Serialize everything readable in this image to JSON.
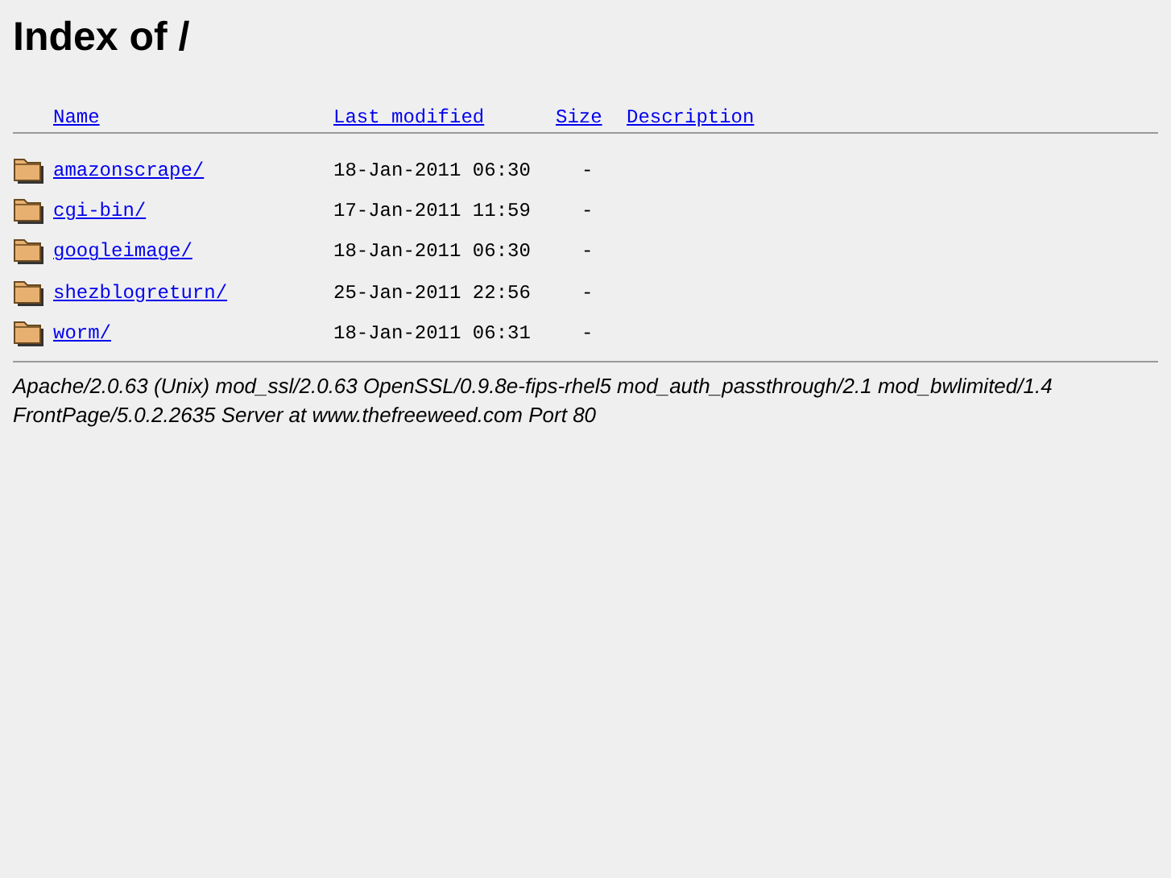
{
  "title": "Index of /",
  "columns": [
    "Name",
    "Last modified",
    "Size",
    "Description"
  ],
  "rows": [
    {
      "name": "amazonscrape/",
      "modified": "18-Jan-2011 06:30",
      "size": "-"
    },
    {
      "name": "cgi-bin/",
      "modified": "17-Jan-2011 11:59",
      "size": "-"
    },
    {
      "name": "googleimage/",
      "modified": "18-Jan-2011 06:30",
      "size": "-"
    },
    {
      "name": "shezblogreturn/",
      "modified": "25-Jan-2011 22:56",
      "size": "-"
    },
    {
      "name": "worm/",
      "modified": "18-Jan-2011 06:31",
      "size": "-"
    }
  ],
  "address": "Apache/2.0.63 (Unix) mod_ssl/2.0.63 OpenSSL/0.9.8e-fips-rhel5 mod_auth_passthrough/2.1 mod_bwlimited/1.4 FrontPage/5.0.2.2635 Server at www.thefreeweed.com Port 80"
}
